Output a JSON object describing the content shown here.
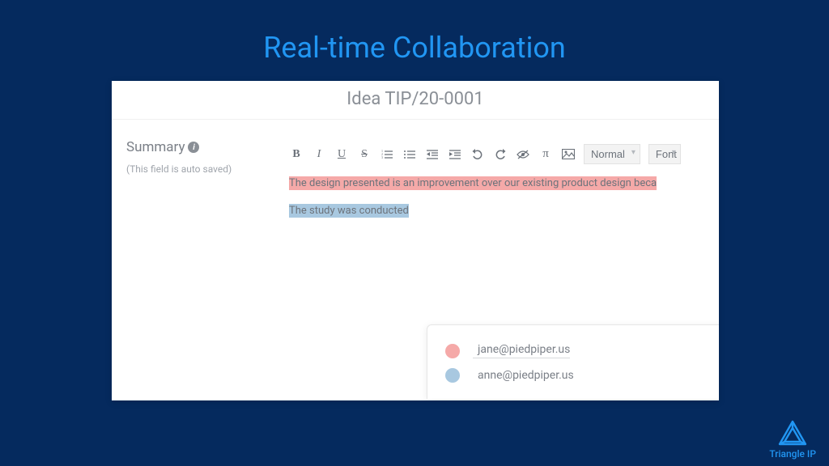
{
  "slide": {
    "title": "Real-time Collaboration"
  },
  "app": {
    "title": "Idea TIP/20-0001",
    "summary_label": "Summary",
    "autosave_note": "(This field is auto saved)"
  },
  "toolbar": {
    "bold": "B",
    "italic": "I",
    "underline": "U",
    "strike": "S",
    "ol": "≣",
    "ul": "≣",
    "outdent": "⇤",
    "indent": "⇥",
    "undo": "↺",
    "redo": "↻",
    "hide": "⦵",
    "pi": "π",
    "image": "▣",
    "style_select": "Normal",
    "font_select": "Font"
  },
  "editor": {
    "line1": "The design presented is an improvement over our existing product design beca",
    "line2": "The study was conducted"
  },
  "collaborators": [
    {
      "color": "pink",
      "email": "jane@piedpiper.us"
    },
    {
      "color": "blue",
      "email": "anne@piedpiper.us"
    }
  ],
  "brand": {
    "name": "Triangle IP"
  }
}
